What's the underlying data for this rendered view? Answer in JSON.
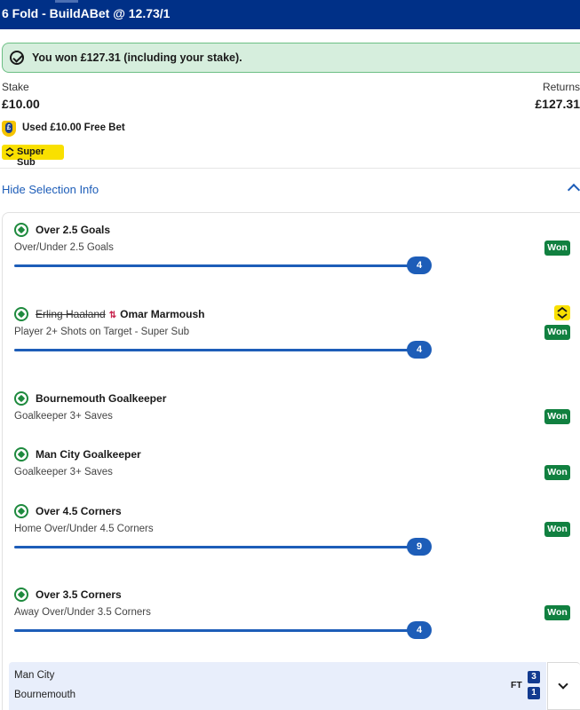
{
  "header": {
    "title": "6 Fold - BuildABet @ 12.73/1"
  },
  "result_banner": {
    "text": "You won £127.31 (including your stake)."
  },
  "bet_summary": {
    "stake_label": "Stake",
    "stake_value": "£10.00",
    "returns_label": "Returns",
    "returns_value": "£127.31",
    "free_bet_text": "Used £10.00 Free Bet",
    "free_bet_icon_glyph": "£",
    "super_sub_label": "Super Sub"
  },
  "selection_info_toggle": "Hide Selection Info",
  "selections": [
    {
      "name": "Over 2.5 Goals",
      "market": "Over/Under 2.5 Goals",
      "status": "Won",
      "progress": "4"
    },
    {
      "replaced_player": "Erling Haaland",
      "name": "Omar Marmoush",
      "market": "Player 2+ Shots on Target - Super Sub",
      "status": "Won",
      "progress": "4"
    },
    {
      "name": "Bournemouth Goalkeeper",
      "market": "Goalkeeper 3+ Saves",
      "status": "Won"
    },
    {
      "name": "Man City Goalkeeper",
      "market": "Goalkeeper 3+ Saves",
      "status": "Won"
    },
    {
      "name": "Over 4.5 Corners",
      "market": "Home Over/Under 4.5 Corners",
      "status": "Won",
      "progress": "9"
    },
    {
      "name": "Over 3.5 Corners",
      "market": "Away Over/Under 3.5 Corners",
      "status": "Won",
      "progress": "4"
    }
  ],
  "match": {
    "home_team": "Man City",
    "away_team": "Bournemouth",
    "status": "FT",
    "home_score": "3",
    "away_score": "1"
  },
  "colors": {
    "header_bg": "#003087",
    "won_green": "#118040",
    "accent_blue": "#1d5db8",
    "super_sub_yellow": "#f9e000"
  }
}
